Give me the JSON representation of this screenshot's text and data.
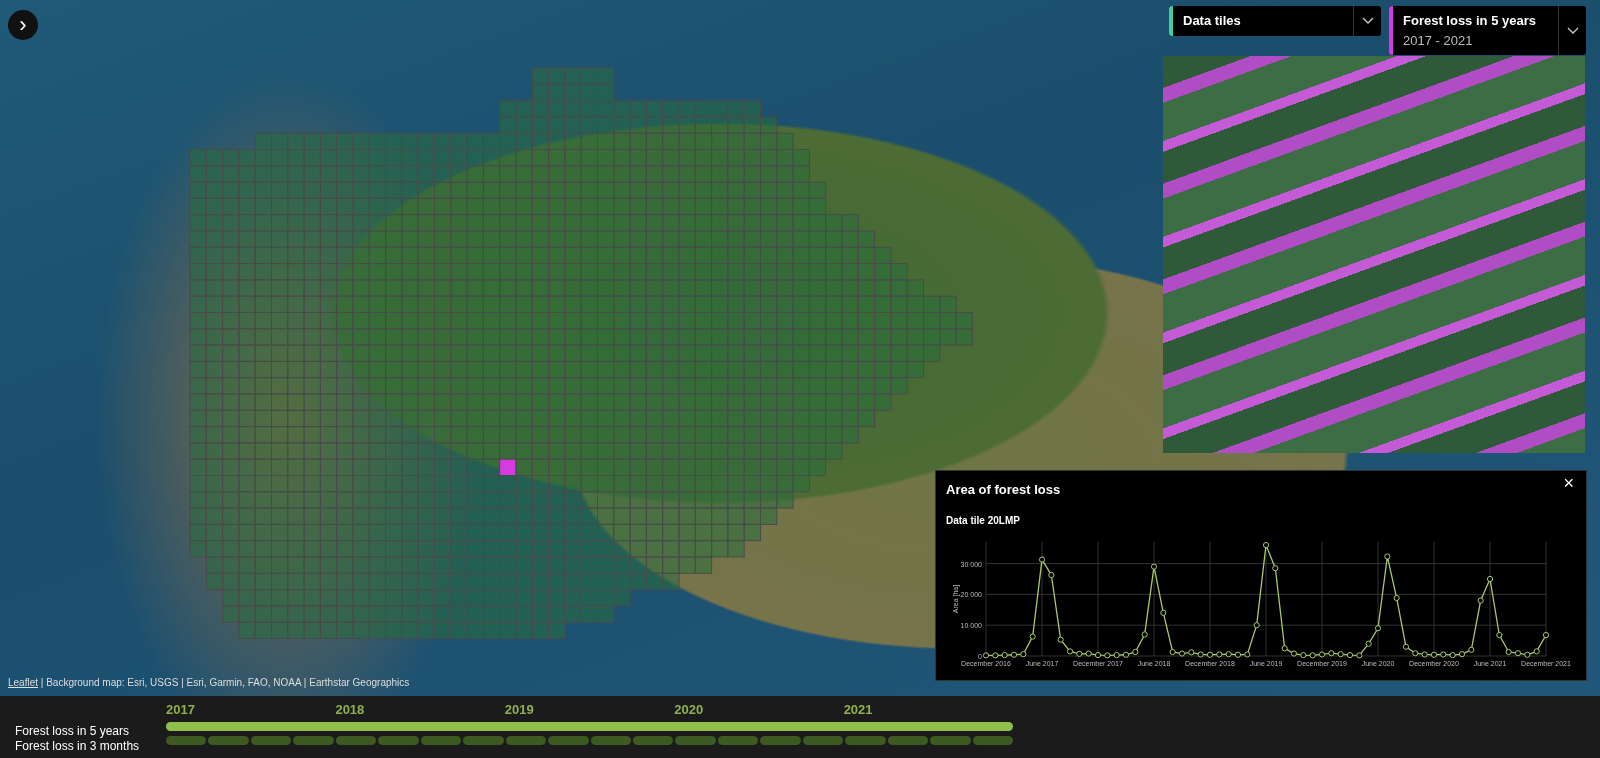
{
  "sidebar_toggle": {
    "icon": "›"
  },
  "layers": [
    {
      "title": "Data tiles",
      "color": "#3ccf9c"
    },
    {
      "title": "Forest loss in 5 years",
      "subtitle": "2017 - 2021",
      "color": "#d63be0"
    }
  ],
  "attribution": {
    "link": "Leaflet",
    "text": "| Background map: Esri, USGS | Esri, Garmin, FAO, NOAA | Earthstar Geographics"
  },
  "chart_panel": {
    "title": "Area of forest loss",
    "close": "×",
    "subtitle": "Data tile 20LMP",
    "chart_data": {
      "type": "line",
      "ylabel": "Area [ha]",
      "categories": [
        "December 2016",
        null,
        null,
        null,
        null,
        null,
        "June 2017",
        null,
        null,
        null,
        null,
        null,
        "December 2017",
        null,
        null,
        null,
        null,
        null,
        "June 2018",
        null,
        null,
        null,
        null,
        null,
        "December 2018",
        null,
        null,
        null,
        null,
        null,
        "June 2019",
        null,
        null,
        null,
        null,
        null,
        "December 2019",
        null,
        null,
        null,
        null,
        null,
        "June 2020",
        null,
        null,
        null,
        null,
        null,
        "December 2020",
        null,
        null,
        null,
        null,
        null,
        "June 2021",
        null,
        null,
        null,
        null,
        null,
        "December 2021"
      ],
      "series": [
        {
          "color": "#a8c86a",
          "marker": true,
          "values": [
            200,
            200,
            300,
            400,
            600,
            6300,
            31300,
            26300,
            5300,
            1500,
            700,
            800,
            300,
            200,
            300,
            400,
            1300,
            7000,
            29000,
            14000,
            1300,
            800,
            1200,
            500,
            400,
            500,
            600,
            400,
            500,
            10000,
            36000,
            28500,
            2500,
            800,
            300,
            200,
            500,
            900,
            600,
            300,
            200,
            4000,
            9000,
            32300,
            18800,
            3000,
            900,
            500,
            400,
            500,
            300,
            600,
            2000,
            18000,
            25000,
            6800,
            1300,
            900,
            400,
            1500,
            6800
          ]
        }
      ],
      "ylim": [
        0,
        37000
      ],
      "grid": true,
      "yticks": [
        {
          "value": 0,
          "label": "0"
        },
        {
          "value": 10000,
          "label": "10 000"
        },
        {
          "value": 20000,
          "label": "20 000"
        },
        {
          "value": 30000,
          "label": "30 000"
        }
      ]
    }
  },
  "timeline": {
    "years": [
      "2017",
      "2018",
      "2019",
      "2020",
      "2021"
    ],
    "rows": [
      {
        "label": "Forest loss in 5 years",
        "kind": "span",
        "selected": true
      },
      {
        "label": "Forest loss in 3 months",
        "kind": "segments",
        "segments": [
          {
            "selected": false
          },
          {
            "selected": false
          },
          {
            "selected": false
          },
          {
            "selected": false
          },
          {
            "selected": false
          },
          {
            "selected": false
          },
          {
            "selected": false
          },
          {
            "selected": false
          },
          {
            "selected": false
          },
          {
            "selected": false
          },
          {
            "selected": false
          },
          {
            "selected": false
          },
          {
            "selected": false
          },
          {
            "selected": false
          },
          {
            "selected": false
          },
          {
            "selected": false
          },
          {
            "selected": false
          },
          {
            "selected": false
          },
          {
            "selected": false
          },
          {
            "selected": false
          }
        ]
      }
    ]
  }
}
